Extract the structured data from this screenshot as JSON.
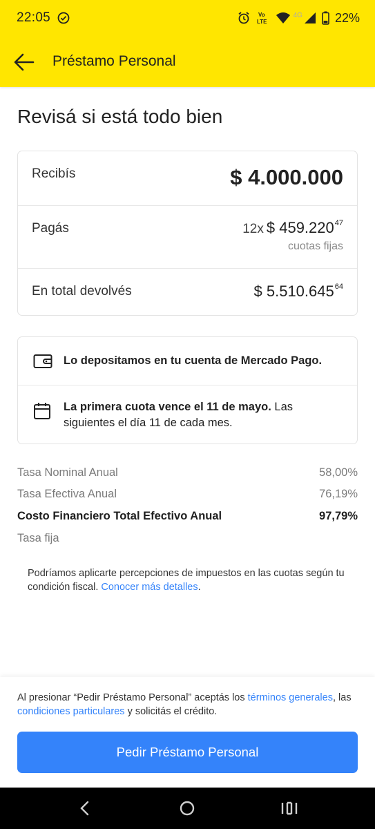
{
  "status_bar": {
    "time": "22:05",
    "network_label": "4G",
    "battery": "22%",
    "lte_label_top": "Vo",
    "lte_label_bottom": "LTE"
  },
  "header": {
    "title": "Préstamo Personal"
  },
  "main": {
    "title": "Revisá si está todo bien",
    "summary": {
      "receive_label": "Recibís",
      "receive_value": "$ 4.000.000",
      "pay_label": "Pagás",
      "pay_count": "12x",
      "pay_value": "$ 459.220",
      "pay_cents": "47",
      "pay_sub": "cuotas fijas",
      "total_label": "En total devolvés",
      "total_value": "$ 5.510.645",
      "total_cents": "64"
    },
    "info": {
      "deposit_text": "Lo depositamos en tu cuenta de Mercado Pago.",
      "first_due_bold": "La primera cuota vence el 11 de mayo.",
      "first_due_rest": " Las siguientes el día 11 de cada mes."
    },
    "rates": [
      {
        "label": "Tasa Nominal Anual",
        "value": "58,00%"
      },
      {
        "label": "Tasa Efectiva Anual",
        "value": "76,19%"
      },
      {
        "label": "Costo Financiero Total Efectivo Anual",
        "value": "97,79%"
      }
    ],
    "fixed_rate": "Tasa fija",
    "fiscal_text": "Podríamos aplicarte percepciones de impuestos en las cuotas según tu condición fiscal. ",
    "fiscal_link": "Conocer más detalles",
    "fiscal_end": "."
  },
  "footer": {
    "terms_1": "Al presionar “Pedir Préstamo Personal” aceptás los ",
    "terms_link_1": "términos generales",
    "terms_2": ", las ",
    "terms_link_2": "condiciones particulares",
    "terms_3": " y solicitás el crédito.",
    "cta": "Pedir Préstamo Personal"
  },
  "colors": {
    "brand_yellow": "#ffe600",
    "primary_blue": "#3483fa"
  }
}
